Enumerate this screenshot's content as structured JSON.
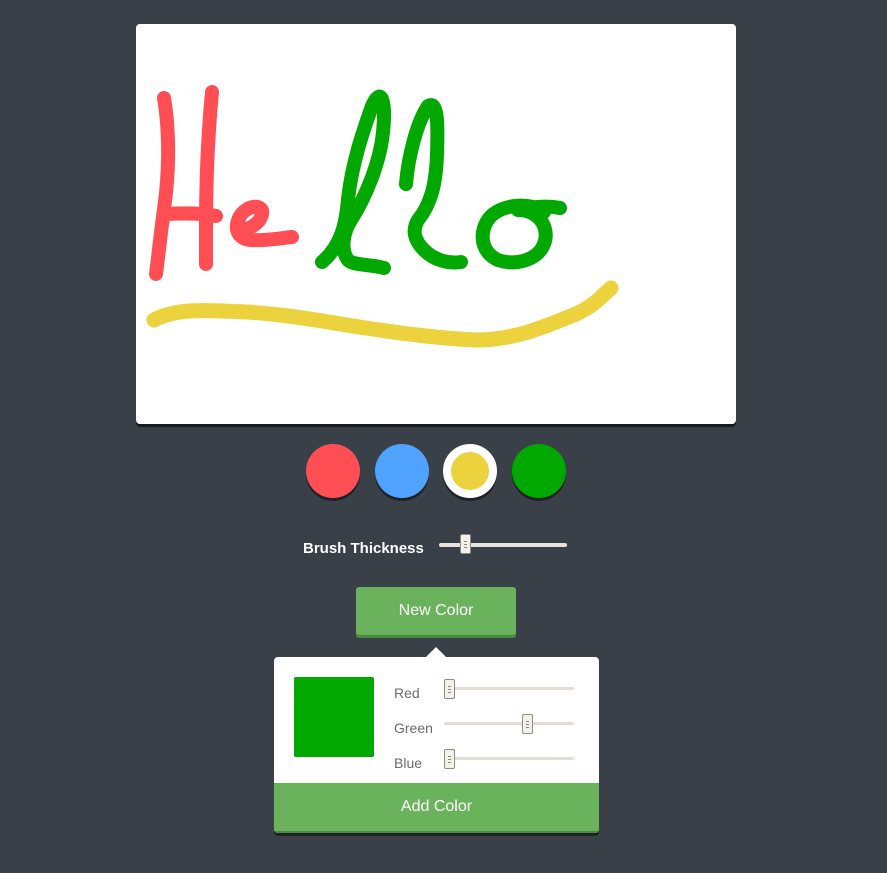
{
  "canvas": {
    "strokes": [
      {
        "name": "H-left-stroke",
        "color": "#ff4f55"
      },
      {
        "name": "H-right-stroke",
        "color": "#ff4f55"
      },
      {
        "name": "H-crossbar-stroke",
        "color": "#ff4f55"
      },
      {
        "name": "e-stroke",
        "color": "#ff4f55"
      },
      {
        "name": "l-first-stroke",
        "color": "#00a800"
      },
      {
        "name": "l-second-stroke",
        "color": "#00a800"
      },
      {
        "name": "o-stroke",
        "color": "#00a800"
      },
      {
        "name": "underline-stroke",
        "color": "#ecd23d"
      }
    ]
  },
  "palette": {
    "colors": [
      "#ff4f55",
      "#4fa3ff",
      "#ecd23d",
      "#00a800"
    ],
    "selected_index": 2
  },
  "brush": {
    "label": "Brush Thickness",
    "value_fraction": 0.18
  },
  "new_color_button": {
    "label": "New Color"
  },
  "color_picker": {
    "preview_color": "#00a800",
    "red": {
      "label": "Red",
      "value": 0
    },
    "green": {
      "label": "Green",
      "value": 168
    },
    "blue": {
      "label": "Blue",
      "value": 0
    },
    "add_label": "Add Color"
  },
  "theme": {
    "background": "#394047",
    "button_green": "#6ab25b"
  }
}
